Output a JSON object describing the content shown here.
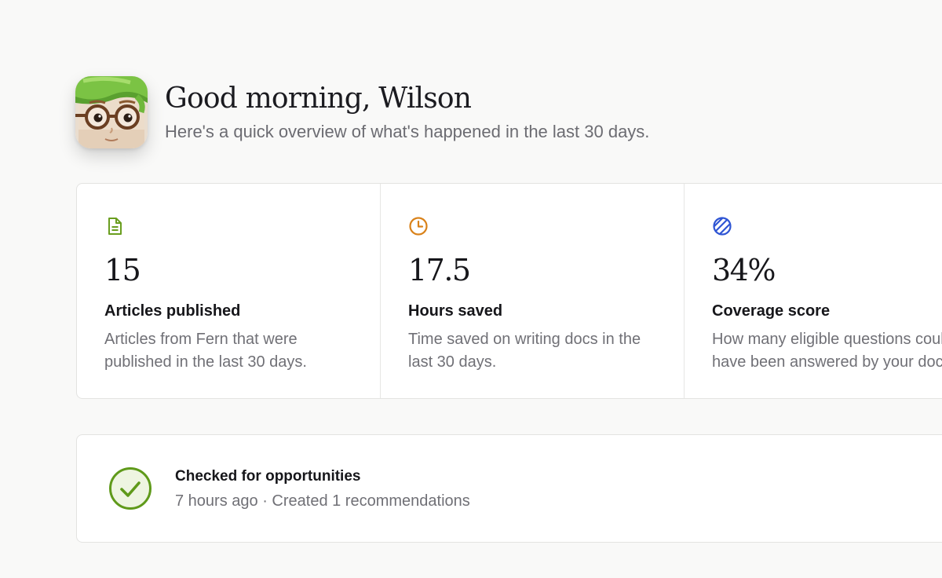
{
  "header": {
    "greeting": "Good morning, Wilson",
    "subtitle": "Here's a quick overview of what's happened in the last 30 days.",
    "avatar_icon": "cartoon-avatar-with-glasses"
  },
  "stats": [
    {
      "icon": "document-icon",
      "icon_color": "#6a9e1f",
      "value": "15",
      "title": "Articles published",
      "desc_line1": "Articles from Fern that were",
      "desc_line2": "published in the last 30 days."
    },
    {
      "icon": "clock-icon",
      "icon_color": "#d9821a",
      "value": "17.5",
      "title": "Hours saved",
      "desc_line1": "Time saved on writing docs in the",
      "desc_line2": "last 30 days."
    },
    {
      "icon": "coverage-icon",
      "icon_color": "#2f55d4",
      "value": "34%",
      "title": "Coverage score",
      "desc_line1": "How many eligible questions could",
      "desc_line2": "have been answered by your docs."
    }
  ],
  "activity": {
    "icon": "check-circle-icon",
    "icon_color": "#5f9a1a",
    "title": "Checked for opportunities",
    "meta": "7 hours ago · Created 1 recommendations"
  }
}
